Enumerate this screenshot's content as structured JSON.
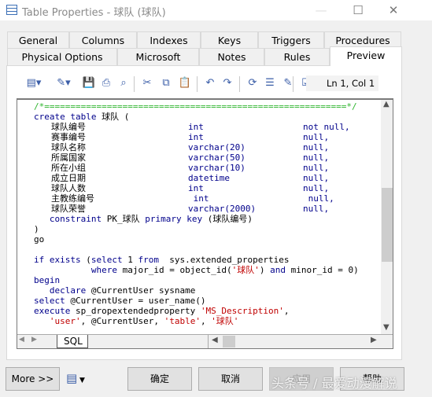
{
  "window": {
    "title": "Table Properties - 球队 (球队)",
    "icon": "table-icon",
    "minimize": "—",
    "maximize": "☐",
    "close": "✕"
  },
  "tabs_row1": [
    "General",
    "Columns",
    "Indexes",
    "Keys",
    "Triggers",
    "Procedures"
  ],
  "tabs_row2": [
    "Physical Options",
    "Microsoft",
    "Notes",
    "Rules",
    "Preview"
  ],
  "selected_tab": "Preview",
  "toolbar": {
    "icons": [
      "editor-menu-icon",
      "properties-menu-icon",
      "save-icon",
      "print-icon",
      "find-icon",
      "cut-icon",
      "copy-icon",
      "paste-icon",
      "undo-icon",
      "redo-icon",
      "refresh-icon",
      "list-icon",
      "edit-icon",
      "check-icon"
    ],
    "position": "Ln 1, Col 1"
  },
  "code": {
    "lines_top": [
      [
        [
          "c",
          "/*==========================================================*/"
        ]
      ],
      [
        [
          "k",
          "create table "
        ],
        [
          "p",
          "球队 ("
        ]
      ]
    ],
    "columns": [
      {
        "name": "球队编号",
        "type": "int",
        "null": "not null,"
      },
      {
        "name": "赛事编号",
        "type": "int",
        "null": "null,"
      },
      {
        "name": "球队名称",
        "type": "varchar(20)",
        "null": "null,"
      },
      {
        "name": "所属国家",
        "type": "varchar(50)",
        "null": "null,"
      },
      {
        "name": "所在小组",
        "type": "varchar(10)",
        "null": "null,"
      },
      {
        "name": "成立日期",
        "type": "datetime",
        "null": "null,"
      },
      {
        "name": "球队人数",
        "type": "int",
        "null": "null,"
      },
      {
        "name": "主教练编号",
        "type": " int",
        "null": " null,"
      },
      {
        "name": "球队荣誉",
        "type": "varchar(2000)",
        "null": "null,"
      }
    ],
    "lines_bottom": [
      [
        [
          "k",
          "   constraint "
        ],
        [
          "p",
          "PK_球队 "
        ],
        [
          "k",
          "primary key "
        ],
        [
          "p",
          "(球队编号)"
        ]
      ],
      [
        [
          "p",
          ")"
        ]
      ],
      [
        [
          "p",
          "go"
        ]
      ],
      [
        [
          "p",
          ""
        ]
      ],
      [
        [
          "k",
          "if exists "
        ],
        [
          "p",
          "("
        ],
        [
          "k",
          "select "
        ],
        [
          "p",
          "1 "
        ],
        [
          "k",
          "from  "
        ],
        [
          "p",
          "sys.extended_properties"
        ]
      ],
      [
        [
          "k",
          "           where "
        ],
        [
          "p",
          "major_id = object_id("
        ],
        [
          "s",
          "'球队'"
        ],
        [
          "p",
          ") "
        ],
        [
          "k",
          "and "
        ],
        [
          "p",
          "minor_id = 0)"
        ]
      ],
      [
        [
          "k",
          "begin"
        ]
      ],
      [
        [
          "k",
          "   declare "
        ],
        [
          "p",
          "@CurrentUser sysname"
        ]
      ],
      [
        [
          "k",
          "select "
        ],
        [
          "p",
          "@CurrentUser = user_name()"
        ]
      ],
      [
        [
          "k",
          "execute "
        ],
        [
          "p",
          "sp_dropextendedproperty "
        ],
        [
          "s",
          "'MS_Description'"
        ],
        [
          "p",
          ","
        ]
      ],
      [
        [
          "s",
          "   'user'"
        ],
        [
          "p",
          ", @CurrentUser, "
        ],
        [
          "s",
          "'table'"
        ],
        [
          "p",
          ", "
        ],
        [
          "s",
          "'球队'"
        ]
      ]
    ],
    "sheet_tab": "SQL"
  },
  "buttons": {
    "more": "More >>",
    "ok": "确定",
    "cancel": "取消",
    "apply": "应用",
    "help": "帮助"
  },
  "watermark": "头条号 / 最爱动漫解说",
  "colors": {
    "keyword": "#00008b",
    "string": "#c00000",
    "comment": "#2fb52f"
  }
}
